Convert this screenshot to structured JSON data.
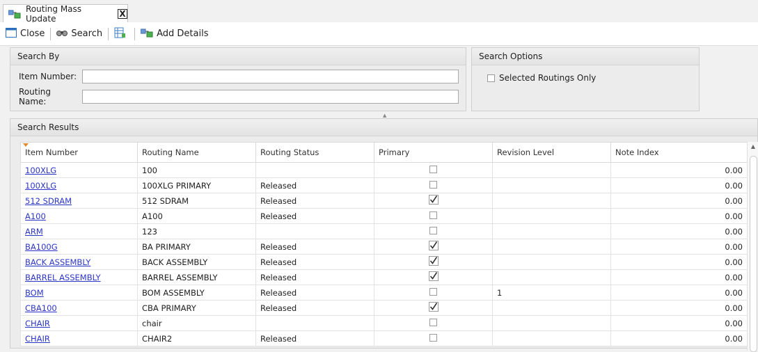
{
  "tab": {
    "title": "Routing Mass Update",
    "close_glyph": "X"
  },
  "toolbar": {
    "close_label": "Close",
    "search_label": "Search",
    "add_details_label": "Add Details"
  },
  "search_by": {
    "header": "Search By",
    "item_number_label": "Item Number:",
    "item_number_value": "",
    "routing_name_label": "Routing Name:",
    "routing_name_value": ""
  },
  "search_options": {
    "header": "Search Options",
    "selected_routings_only_label": "Selected Routings Only",
    "selected_routings_only_checked": false
  },
  "results": {
    "header": "Search Results",
    "columns": [
      "Item Number",
      "Routing Name",
      "Routing Status",
      "Primary",
      "Revision Level",
      "Note Index"
    ],
    "rows": [
      {
        "item": "100XLG",
        "routing": "100",
        "status": "",
        "primary": false,
        "revision": "",
        "note": "0.00"
      },
      {
        "item": "100XLG",
        "routing": "100XLG PRIMARY",
        "status": "Released",
        "primary": false,
        "revision": "",
        "note": "0.00"
      },
      {
        "item": "512 SDRAM",
        "routing": "512 SDRAM",
        "status": "Released",
        "primary": true,
        "revision": "",
        "note": "0.00"
      },
      {
        "item": "A100",
        "routing": "A100",
        "status": "Released",
        "primary": false,
        "revision": "",
        "note": "0.00"
      },
      {
        "item": "ARM",
        "routing": "123",
        "status": "",
        "primary": false,
        "revision": "",
        "note": "0.00"
      },
      {
        "item": "BA100G",
        "routing": "BA PRIMARY",
        "status": "Released",
        "primary": true,
        "revision": "",
        "note": "0.00"
      },
      {
        "item": "BACK ASSEMBLY",
        "routing": "BACK ASSEMBLY",
        "status": "Released",
        "primary": true,
        "revision": "",
        "note": "0.00"
      },
      {
        "item": "BARREL ASSEMBLY",
        "routing": "BARREL ASSEMBLY",
        "status": "Released",
        "primary": true,
        "revision": "",
        "note": "0.00"
      },
      {
        "item": "BOM",
        "routing": "BOM ASSEMBLY",
        "status": "Released",
        "primary": false,
        "revision": "1",
        "note": "0.00"
      },
      {
        "item": "CBA100",
        "routing": "CBA PRIMARY",
        "status": "Released",
        "primary": true,
        "revision": "",
        "note": "0.00"
      },
      {
        "item": "CHAIR",
        "routing": "chair",
        "status": "",
        "primary": false,
        "revision": "",
        "note": "0.00"
      },
      {
        "item": "CHAIR",
        "routing": "CHAIR2",
        "status": "Released",
        "primary": false,
        "revision": "",
        "note": "0.00"
      }
    ]
  },
  "colors": {
    "link": "#2b35c8",
    "sort_indicator": "#e38a2e"
  }
}
